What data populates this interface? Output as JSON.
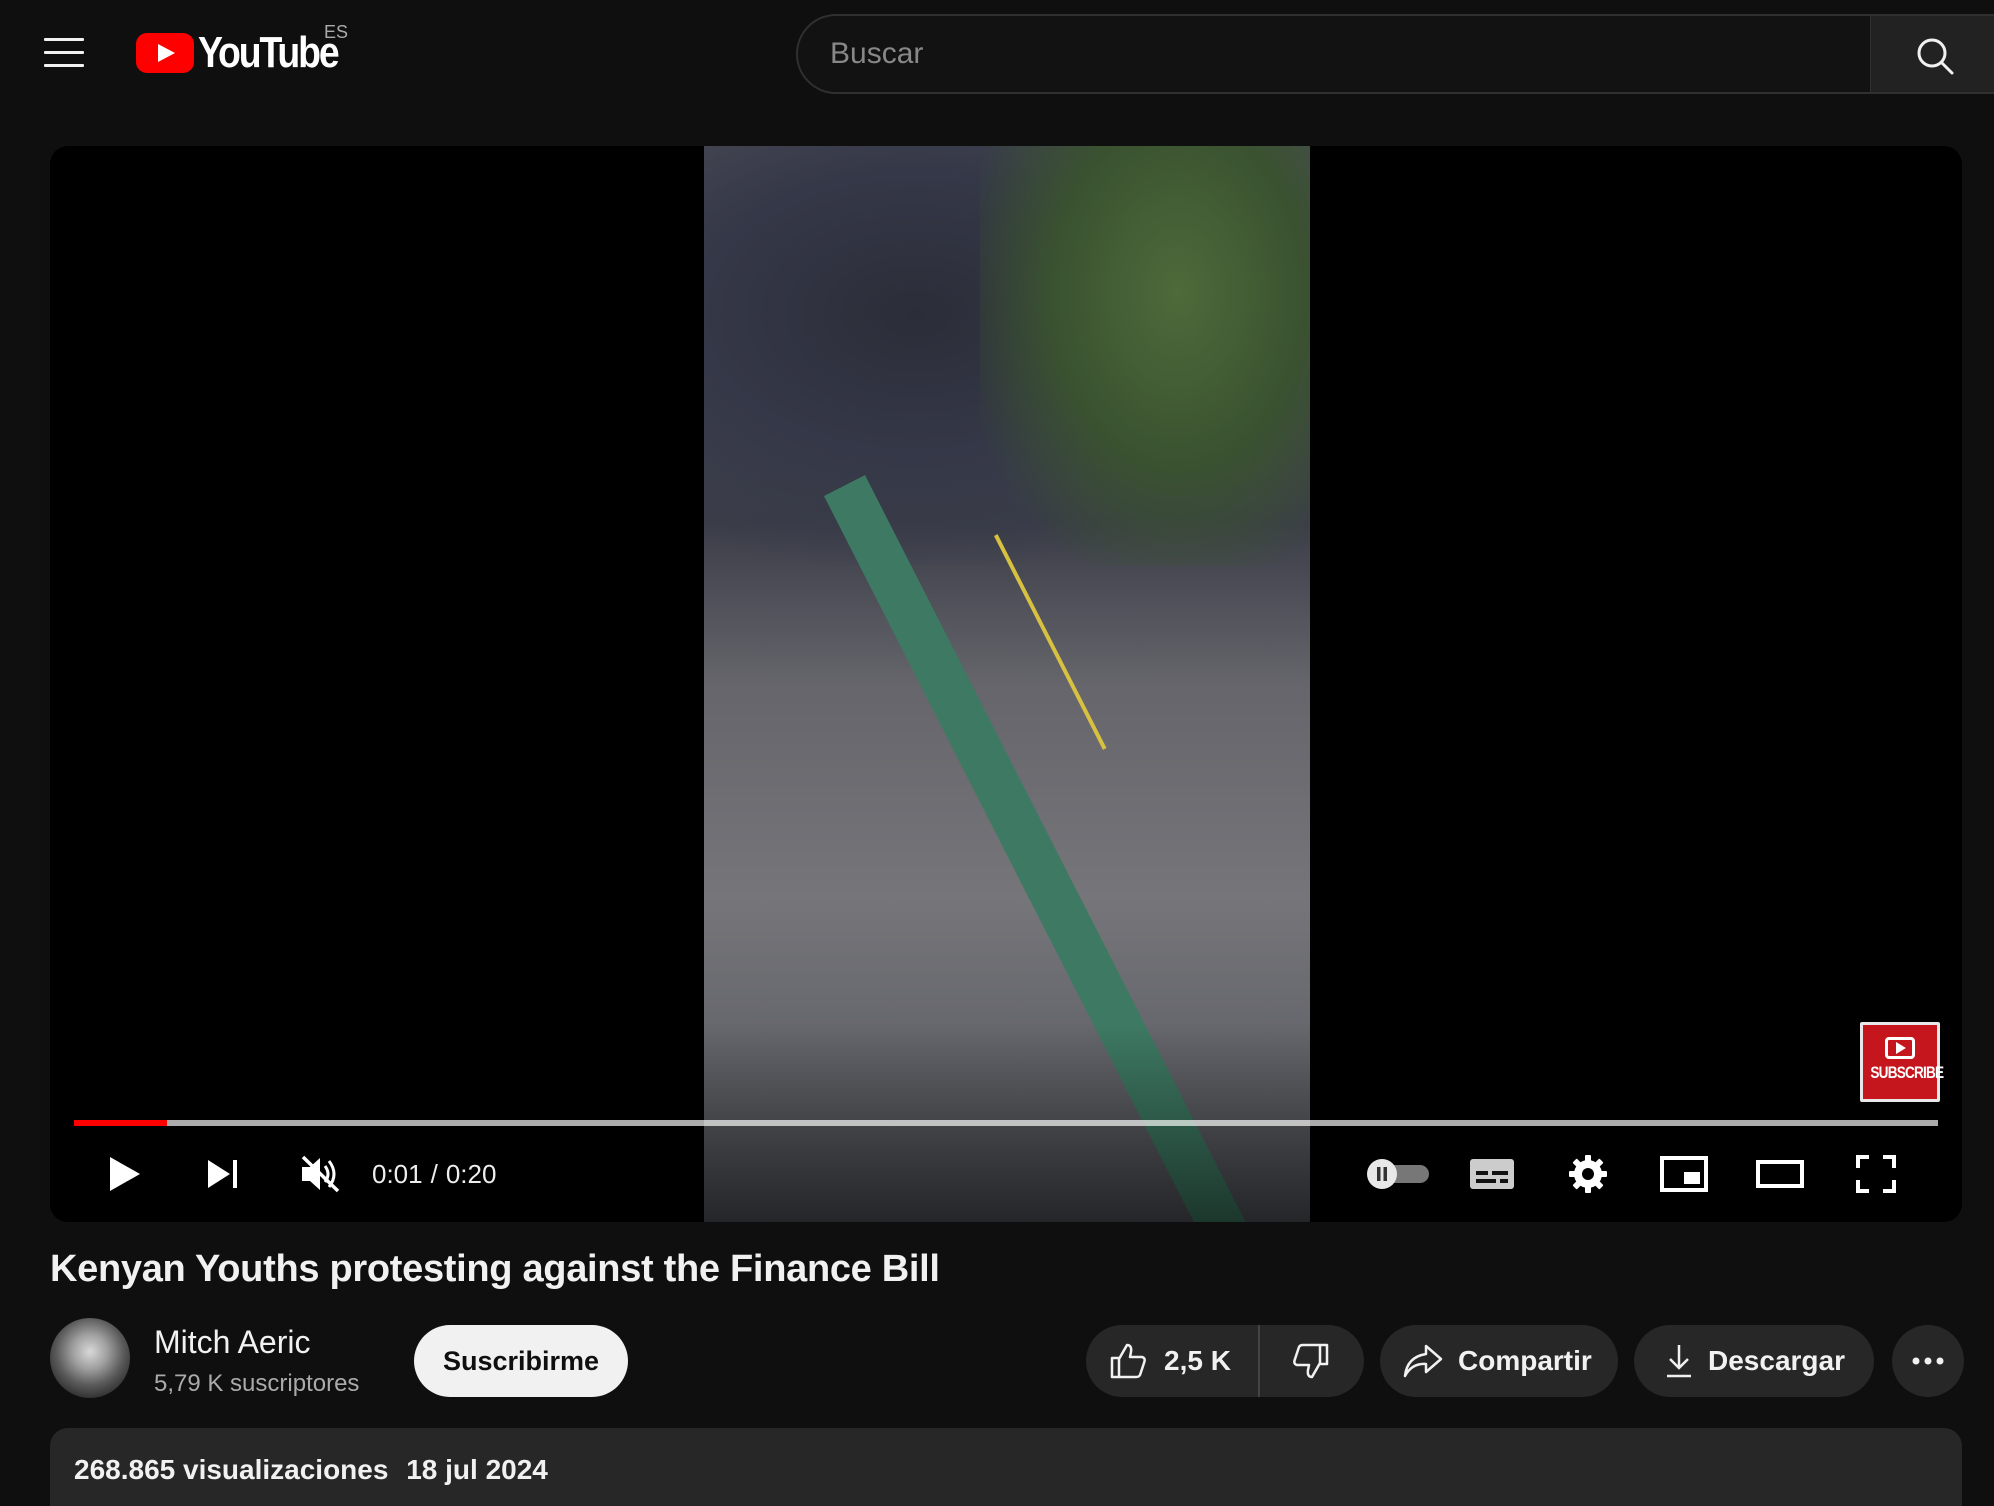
{
  "header": {
    "logo_text": "YouTube",
    "country_code": "ES",
    "search_placeholder": "Buscar"
  },
  "player": {
    "current_time": "0:01",
    "separator": "/",
    "duration": "0:20",
    "progress_fraction": 0.05,
    "loaded_fraction": 1.0,
    "watermark_text": "SUBSCRIBE",
    "muted": true
  },
  "video": {
    "title": "Kenyan Youths protesting against the Finance Bill",
    "channel_name": "Mitch Aeric",
    "subscribers": "5,79 K suscriptores",
    "subscribe_label": "Suscribirme",
    "likes": "2,5 K",
    "share_label": "Compartir",
    "download_label": "Descargar",
    "views": "268.865 visualizaciones",
    "date": "18 jul 2024"
  },
  "colors": {
    "background": "#0f0f0f",
    "accent_red": "#ff0000",
    "pill_bg": "#272727"
  }
}
